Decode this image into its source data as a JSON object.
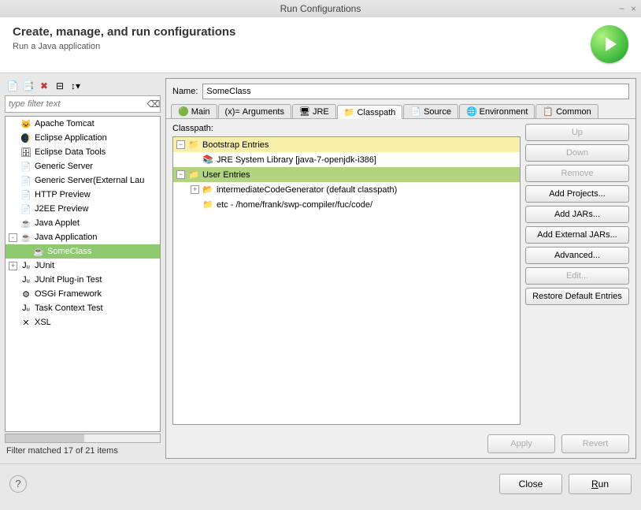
{
  "window": {
    "title": "Run Configurations"
  },
  "header": {
    "title": "Create, manage, and run configurations",
    "subtitle": "Run a Java application"
  },
  "filter": {
    "placeholder": "type filter text"
  },
  "tree": {
    "items": [
      {
        "label": "Apache Tomcat",
        "indent": 1
      },
      {
        "label": "Eclipse Application",
        "indent": 1
      },
      {
        "label": "Eclipse Data Tools",
        "indent": 1
      },
      {
        "label": "Generic Server",
        "indent": 1
      },
      {
        "label": "Generic Server(External Lau",
        "indent": 1
      },
      {
        "label": "HTTP Preview",
        "indent": 1
      },
      {
        "label": "J2EE Preview",
        "indent": 1
      },
      {
        "label": "Java Applet",
        "indent": 1
      },
      {
        "label": "Java Application",
        "indent": 1,
        "exp": "-"
      },
      {
        "label": "SomeClass",
        "indent": 2,
        "selected": true
      },
      {
        "label": "JUnit",
        "indent": 1,
        "exp": "+"
      },
      {
        "label": "JUnit Plug-in Test",
        "indent": 1
      },
      {
        "label": "OSGi Framework",
        "indent": 1
      },
      {
        "label": "Task Context Test",
        "indent": 1
      },
      {
        "label": "XSL",
        "indent": 1
      }
    ]
  },
  "filterStatus": "Filter matched 17 of 21 items",
  "nameField": {
    "label": "Name:",
    "value": "SomeClass"
  },
  "tabs": [
    "Main",
    "Arguments",
    "JRE",
    "Classpath",
    "Source",
    "Environment",
    "Common"
  ],
  "activeTab": "Classpath",
  "classpath": {
    "label": "Classpath:",
    "entries": {
      "bootstrap": {
        "label": "Bootstrap Entries",
        "children": [
          "JRE System Library [java-7-openjdk-i386]"
        ]
      },
      "user": {
        "label": "User Entries",
        "children": [
          "intermediateCodeGenerator (default classpath)",
          "etc - /home/frank/swp-compiler/fuc/code/"
        ]
      }
    },
    "buttons": [
      "Up",
      "Down",
      "Remove",
      "Add Projects...",
      "Add JARs...",
      "Add External JARs...",
      "Advanced...",
      "Edit...",
      "Restore Default Entries"
    ],
    "disabled": [
      0,
      1,
      2,
      7
    ]
  },
  "buttons": {
    "apply": "Apply",
    "revert": "Revert",
    "close": "Close",
    "run": "Run"
  }
}
